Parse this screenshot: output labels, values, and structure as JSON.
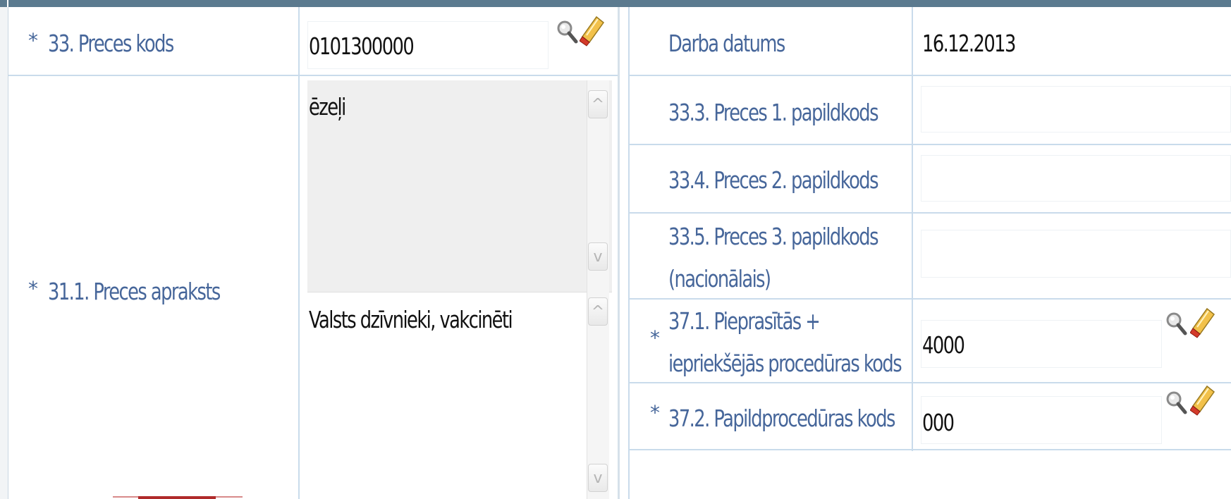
{
  "left": {
    "goods_code": {
      "label": "33. Preces kods",
      "value": "0101300000"
    },
    "description": {
      "label": "31.1. Preces apraksts",
      "text1": "ēzeļi",
      "text2": "Valsts dzīvnieki, vakcinēti"
    }
  },
  "right": {
    "work_date": {
      "label": "Darba datums",
      "value": "16.12.2013"
    },
    "add_code_1": {
      "label": "33.3. Preces 1. papildkods",
      "value": ""
    },
    "add_code_2": {
      "label": "33.4. Preces 2. papildkods",
      "value": ""
    },
    "add_code_3": {
      "label_line1": "33.5. Preces 3. papildkods",
      "label_line2": "(nacionālais)",
      "value": ""
    },
    "procedure_code": {
      "label_line1": "37.1. Pieprasītās +",
      "label_line2": "iepriekšējās procedūras kods",
      "value": "4000"
    },
    "additional_procedure": {
      "label": "37.2. Papildprocedūras kods",
      "value": "000"
    }
  },
  "required_marker": "*",
  "scroll_up_glyph": "^",
  "scroll_down_glyph": "v",
  "icons": {
    "search": "magnifier-icon",
    "clear": "eraser-icon"
  },
  "colors": {
    "label": "#46669a",
    "border": "#c9dbeb",
    "header": "#5b7a8f"
  }
}
